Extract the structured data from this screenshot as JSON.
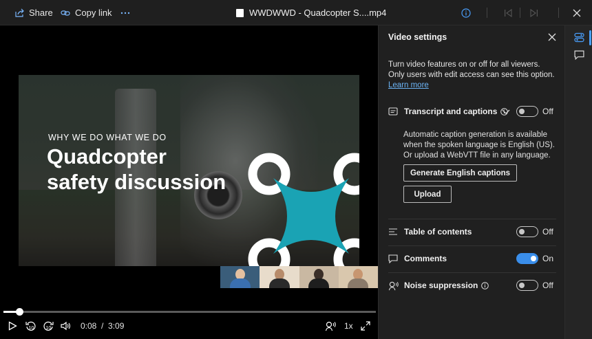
{
  "topbar": {
    "share_label": "Share",
    "copy_link_label": "Copy link",
    "more_icon": "ellipsis-icon",
    "file_title": "WWDWWD - Quadcopter S....mp4"
  },
  "slide": {
    "kicker": "WHY WE DO WHAT WE DO",
    "headline_line1": "Quadcopter",
    "headline_line2": "safety discussion",
    "logo_color": "#1aa3b4"
  },
  "player": {
    "current_time": "0:08",
    "separator": "/",
    "duration": "3:09",
    "speed_label": "1x",
    "progress_fraction": 0.042,
    "rewind_seconds": "10",
    "forward_seconds": "10"
  },
  "panel": {
    "title": "Video settings",
    "description": "Turn video features on or off for all viewers. Only users with edit access can see this option.",
    "learn_more": "Learn more",
    "transcript": {
      "label": "Transcript and captions",
      "state": "Off",
      "details": "Automatic caption generation is available when the spoken language is English (US). Or upload a WebVTT file in any language.",
      "generate_button": "Generate English captions",
      "upload_button": "Upload"
    },
    "toc": {
      "label": "Table of contents",
      "state": "Off"
    },
    "comments": {
      "label": "Comments",
      "state": "On"
    },
    "noise": {
      "label": "Noise suppression",
      "state": "Off"
    }
  },
  "colors": {
    "accent": "#3a8eea",
    "link": "#6cb4f5",
    "panel_bg": "#202020"
  }
}
